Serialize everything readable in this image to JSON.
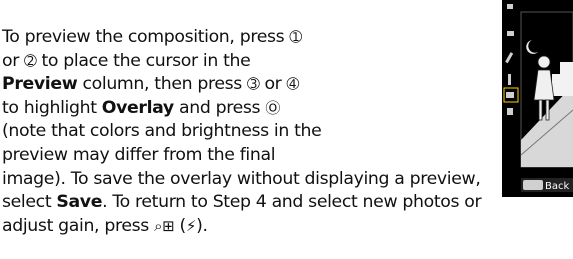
{
  "paragraph": {
    "l1_a": "To preview the composition, press ",
    "l1_sym": "➀",
    "l2_a": "or ",
    "l2_sym": "➁",
    "l2_b": " to place the cursor in the",
    "l3_bold": "Preview",
    "l3_b": " column, then press ",
    "l3_sym1": "➂",
    "l3_c": " or ",
    "l3_sym2": "➃",
    "l4_a": "to highlight ",
    "l4_bold": "Overlay",
    "l4_b": " and press ",
    "l4_sym": "Ⓞ",
    "l5": "(note that colors and brightness in the",
    "l6": "preview may differ from the final",
    "l7": "image). To save the overlay without displaying a preview,",
    "l8_a": "select ",
    "l8_bold": "Save",
    "l8_b": ". To return to Step 4 and select new photos or",
    "l9_a": "adjust gain, press ",
    "l9_sym": "⌕⊞",
    "l9_b": " (",
    "l9_sym2": "⚡",
    "l9_c": ")."
  },
  "camera_screen": {
    "back_button_label": "Back",
    "menu_icons": [
      "camera-icon",
      "movie-icon",
      "pencil-icon",
      "wrench-icon",
      "retouch-icon",
      "recent-icon"
    ],
    "colors": {
      "background": "#000000",
      "scene": "#d8d8d8",
      "highlight": "#ffd200"
    }
  }
}
